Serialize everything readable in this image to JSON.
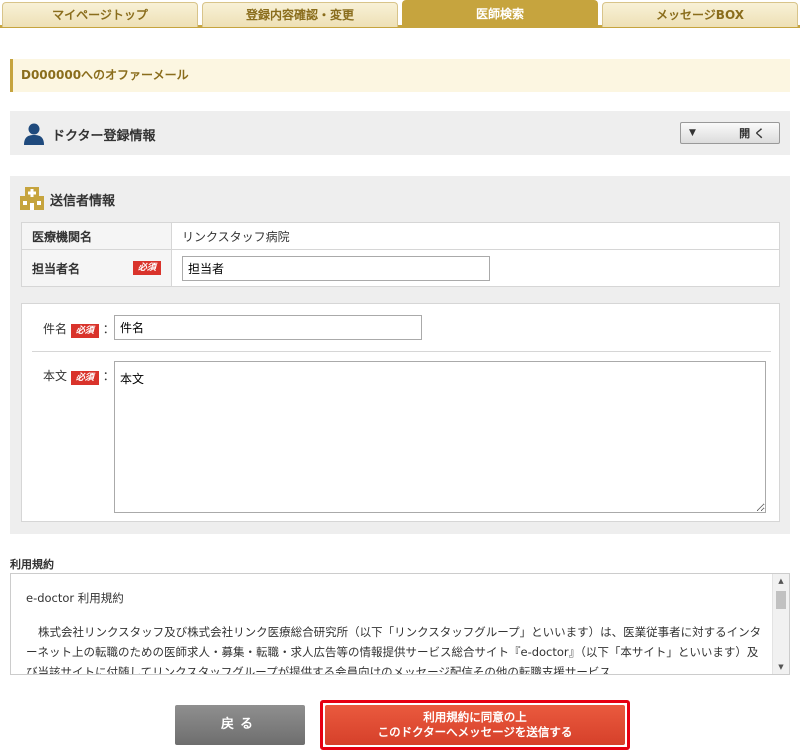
{
  "tabs": [
    {
      "label": "マイページトップ",
      "active": false
    },
    {
      "label": "登録内容確認・変更",
      "active": false
    },
    {
      "label": "医師検索",
      "active": true
    },
    {
      "label": "メッセージBOX",
      "active": false
    }
  ],
  "offer_title": "D000000へのオファーメール",
  "doctor_section": {
    "title": "ドクター登録情報",
    "toggle_label": "開 く",
    "toggle_icon": "triangle-down-icon"
  },
  "sender_section": {
    "title": "送信者情報",
    "rows": [
      {
        "label": "医療機関名",
        "value": "リンクスタッフ病院"
      },
      {
        "label": "担当者名",
        "required_label": "必須",
        "value": "担当者"
      }
    ]
  },
  "mail": {
    "subject_label": "件名",
    "subject_required": "必須",
    "subject_value": "件名",
    "body_label": "本文",
    "body_required": "必須",
    "body_value": "本文",
    "colon": "："
  },
  "terms": {
    "label": "利用規約",
    "heading": "e-doctor 利用規約",
    "body": "株式会社リンクスタッフ及び株式会社リンク医療総合研究所（以下「リンクスタッフグループ」といいます）は、医業従事者に対するインターネット上の転職のための医師求人・募集・転職・求人広告等の情報提供サービス総合サイト『e-doctor』（以下「本サイト」といいます）及び当該サイトに付随してリンクスタッフグループが提供する会員向けのメッセージ配信その他の転職支援サービス"
  },
  "buttons": {
    "back": "戻る",
    "send_line1": "利用規約に同意の上",
    "send_line2": "このドクターへメッセージを送信する"
  },
  "colors": {
    "accent": "#c6a43e",
    "panel": "#eeeeee",
    "required": "#d9332b",
    "send": "#e04a33",
    "send_outline": "#e60012"
  }
}
